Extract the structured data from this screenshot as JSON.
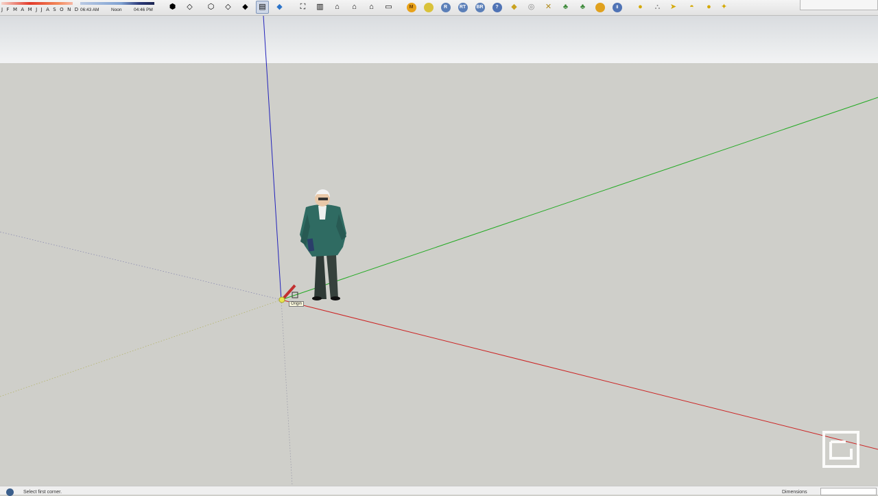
{
  "toolbar": {
    "months": "J F M A M J J A S O N D",
    "sunrise": "06:43 AM",
    "noon": "Noon",
    "sunset": "04:46 PM",
    "groups": {
      "views": [
        "iso-view-icon",
        "top-view-icon",
        "front-view-icon",
        "right-view-icon",
        "back-view-icon",
        "left-view-icon",
        "bottom-view-icon"
      ],
      "styles": [
        "xray-icon",
        "back-edges-icon",
        "wireframe-icon",
        "hidden-line-icon",
        "shaded-icon"
      ],
      "section": [
        "section-plane-icon",
        "display-section-cuts-icon",
        "display-section-planes-icon",
        "model-info-icon",
        "warehouse-icon"
      ]
    },
    "plugins": [
      "M",
      "",
      "R",
      "RT",
      "BR",
      "?",
      "",
      "",
      "",
      "",
      "",
      ""
    ],
    "extras": [
      "sun-icon",
      "lamp-icon",
      "spotlight-icon",
      "dome-light-icon",
      "sphere-icon",
      "omni-light-icon"
    ]
  },
  "viewport": {
    "tooltip": "Origin",
    "colors": {
      "red_axis": "#cc2222",
      "green_axis": "#22aa22",
      "blue_axis": "#2222bb",
      "ground": "#cfcfca"
    }
  },
  "status": {
    "hint": "Select first corner.",
    "measurements_label": "Dimensions",
    "measurements_value": ""
  }
}
